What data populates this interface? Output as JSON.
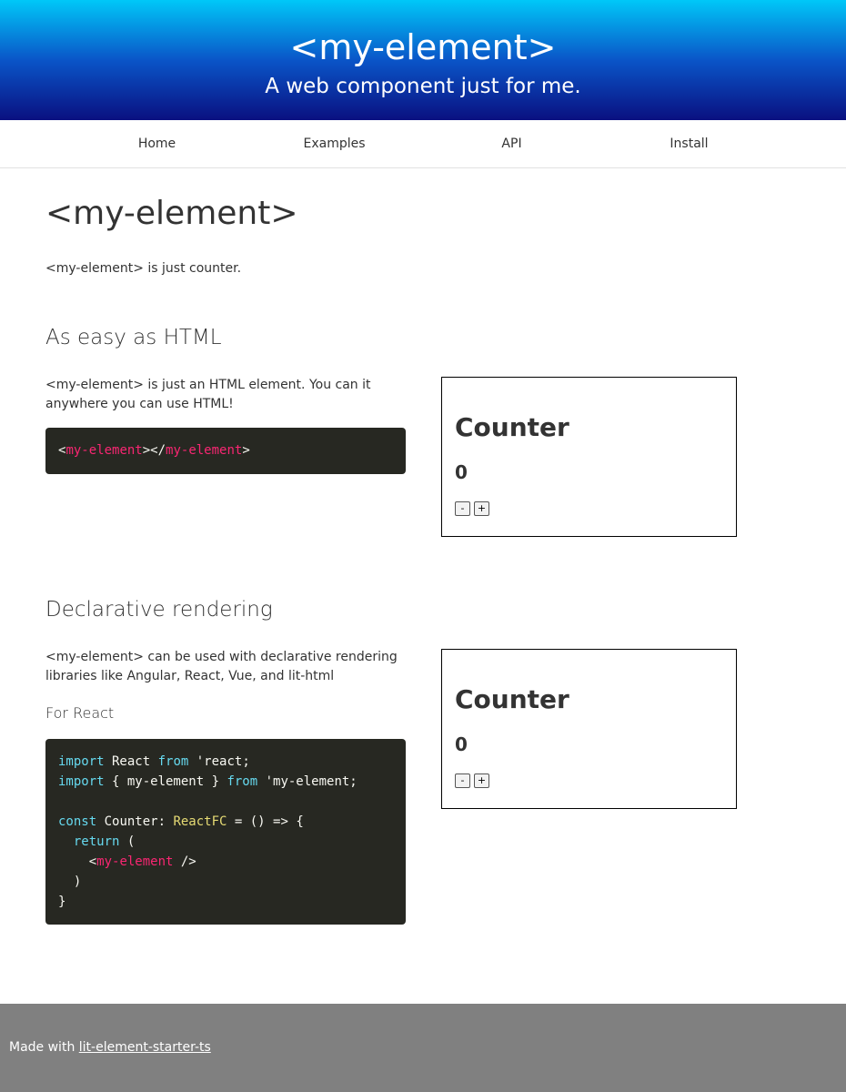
{
  "header": {
    "title": "<my-element>",
    "subtitle": "A web component just for me."
  },
  "nav": [
    "Home",
    "Examples",
    "API",
    "Install"
  ],
  "page": {
    "title": "<my-element>",
    "intro_tag": "<my-element>",
    "intro_text": " is just counter."
  },
  "section1": {
    "title": "As easy as HTML",
    "text_tag": "<my-element>",
    "text": " is just an HTML element. You can it anywhere you can use HTML!",
    "code": {
      "open_bracket": "<",
      "tag": "my-element",
      "mid": "></",
      "close_tag": "my-element",
      "close_bracket": ">"
    }
  },
  "section2": {
    "title": "Declarative rendering",
    "text_tag": "<my-element>",
    "text": " can be used with declarative rendering libraries like Angular, React, Vue, and lit-html",
    "subtitle": "For React",
    "code": {
      "import": "import",
      "from": "from",
      "react_name": " React ",
      "react_src": " 'react;",
      "braces": " { my-element } ",
      "el_src": " 'my-element;",
      "const": "const",
      "counter_name": " Counter: ",
      "reactfc": "ReactFC",
      "arrow": " = () => {",
      "return": "return",
      "paren_open": " (",
      "lt": "<",
      "tag": "my-element",
      "self_close": " />",
      "paren_close": ")",
      "brace_close": "}"
    }
  },
  "counter": {
    "title": "Counter",
    "value": "0",
    "minus": "-",
    "plus": "+"
  },
  "footer": {
    "prefix": "Made with ",
    "link": "lit-element-starter-ts"
  }
}
